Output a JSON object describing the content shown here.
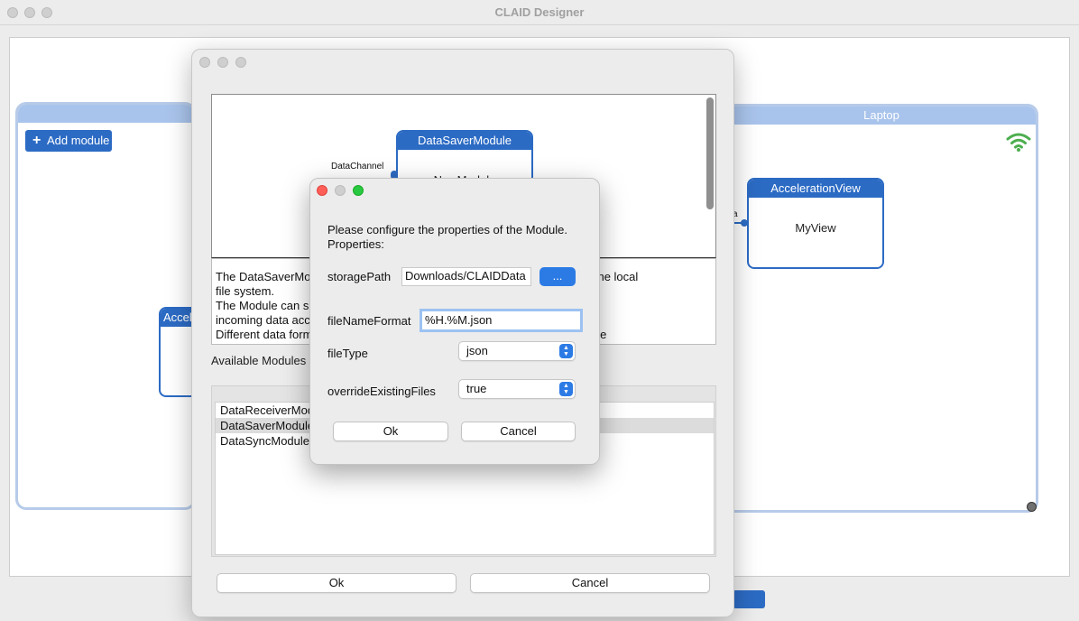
{
  "app": {
    "title": "CLAID Designer"
  },
  "canvas": {
    "add_module_label": "Add module",
    "laptop_device_label": "Laptop",
    "partial_module_label": "Accel",
    "acceleration_view": {
      "title": "AccelerationView",
      "body": "MyView"
    },
    "data_saver_node": {
      "title": "DataSaverModule",
      "body": "NewModule",
      "channel_label": "DataChannel"
    },
    "edge_label_fragment": "a"
  },
  "module_dialog": {
    "description_lines": [
      "The DataSaverModule can save data received from a channel to files on the local",
      "file system.",
      "The Module can subscribe to any channel and automatically serialzes",
      "incoming data according to the specified format.",
      "Different data formats are supported, and various options (store data in one"
    ],
    "available_modules_label": "Available Modules",
    "modules": [
      "DataReceiverModule",
      "DataSaverModule",
      "DataSyncModule"
    ],
    "selected_index": 1,
    "ok_label": "Ok",
    "cancel_label": "Cancel"
  },
  "properties_dialog": {
    "intro": "Please configure the properties of the Module.",
    "properties_heading": "Properties:",
    "storage_path": {
      "label": "storagePath",
      "value": "Downloads/CLAIDData",
      "browse_label": "..."
    },
    "file_name_format": {
      "label": "fileNameFormat",
      "value": "%H.%M.json"
    },
    "file_type": {
      "label": "fileType",
      "value": "json"
    },
    "override_existing_files": {
      "label": "overrideExistingFiles",
      "value": "true"
    },
    "ok_label": "Ok",
    "cancel_label": "Cancel"
  },
  "colors": {
    "accent": "#2c6bc4",
    "device_header": "#a9c4ec",
    "wifi_green": "#4cae4f",
    "traffic_red": "#ff5f57",
    "traffic_yellow": "#febc2e",
    "traffic_green": "#28c840"
  }
}
